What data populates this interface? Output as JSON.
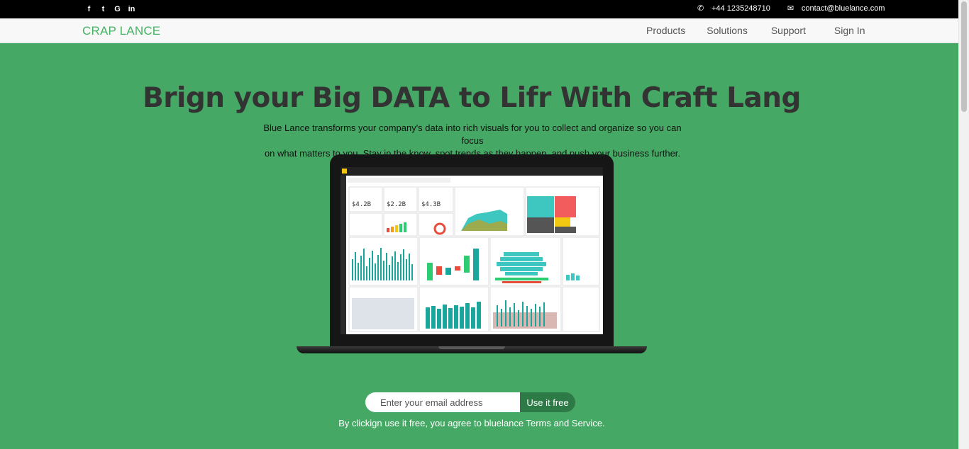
{
  "topbar": {
    "social_icons": [
      "facebook-icon",
      "twitter-icon",
      "google-plus-icon",
      "linkedin-icon"
    ],
    "social_glyphs": [
      "f",
      "t",
      "G",
      "in"
    ],
    "phone_icon": "phone-icon",
    "phone": "+44 1235248710",
    "email_icon": "envelope-icon",
    "email": "contact@bluelance.com"
  },
  "navbar": {
    "brand": "CRAP LANCE",
    "items": [
      "Products",
      "Solutions",
      "Support",
      "Sign In"
    ]
  },
  "hero": {
    "title": "Brign your Big DATA to Lifr With Craft Lang",
    "subtitle_line1": "Blue Lance transforms your company's data into rich visuals for you to collect and organize so you can focus",
    "subtitle_line2": "on what matters to you. Stay in the know, spot trends as they happen, and push your business further."
  },
  "signup": {
    "placeholder": "Enter your email address",
    "button": "Use it free",
    "terms": "By clickign use it free, you agree to bluelance Terms and Service."
  },
  "colors": {
    "background": "#45a965",
    "brand": "#45b363",
    "button": "#2e7a47",
    "topbar": "#000000"
  }
}
